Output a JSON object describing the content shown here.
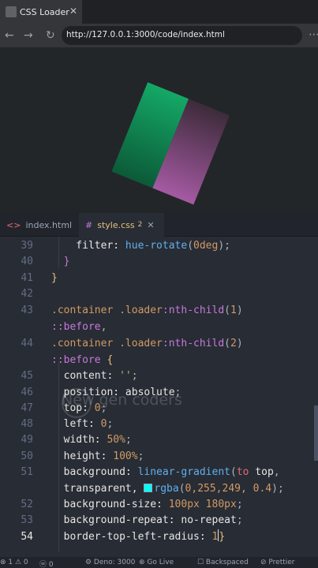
{
  "browser": {
    "tab_title": "CSS Loader",
    "tab_close": "✕",
    "back": "←",
    "forward": "→",
    "reload": "↻",
    "url": "http://127.0.0.1:3000/code/index.html",
    "more": "⋯"
  },
  "preview": {
    "square_green": "#0e7a4a",
    "square_purple": "#7d3d78"
  },
  "editor_tabs": [
    {
      "icon": "<>",
      "label": "index.html",
      "active": false
    },
    {
      "icon": "#",
      "label": "style.css",
      "badge": "2",
      "close": "✕",
      "active": true
    }
  ],
  "code": {
    "lines": [
      {
        "num": "39",
        "tokens": [
          [
            "prop",
            "    filter: "
          ],
          [
            "fn",
            "hue-rotate"
          ],
          [
            "punc",
            "("
          ],
          [
            "num",
            "0deg"
          ],
          [
            "punc",
            ");"
          ]
        ]
      },
      {
        "num": "40",
        "tokens": [
          [
            "brace-p",
            "  }"
          ]
        ]
      },
      {
        "num": "41",
        "tokens": [
          [
            "brace-y",
            "}"
          ]
        ]
      },
      {
        "num": "42",
        "tokens": []
      },
      {
        "num": "43",
        "tokens": [
          [
            "sel",
            ".container .loader"
          ],
          [
            "pseudo",
            ":nth-child"
          ],
          [
            "punc",
            "("
          ],
          [
            "num",
            "1"
          ],
          [
            "punc",
            ")"
          ]
        ]
      },
      {
        "num": "",
        "tokens": [
          [
            "pseudo",
            "::before"
          ],
          [
            "punc",
            ","
          ]
        ]
      },
      {
        "num": "44",
        "tokens": [
          [
            "sel",
            ".container .loader"
          ],
          [
            "pseudo",
            ":nth-child"
          ],
          [
            "punc",
            "("
          ],
          [
            "num",
            "2"
          ],
          [
            "punc",
            ")"
          ]
        ]
      },
      {
        "num": "",
        "tokens": [
          [
            "pseudo",
            "::before "
          ],
          [
            "brace-y",
            "{"
          ]
        ]
      },
      {
        "num": "45",
        "tokens": [
          [
            "prop",
            "  content: "
          ],
          [
            "str",
            "''"
          ],
          [
            "punc",
            ";"
          ]
        ]
      },
      {
        "num": "46",
        "tokens": [
          [
            "prop",
            "  position: "
          ],
          [
            "val",
            "absolute"
          ],
          [
            "punc",
            ";"
          ]
        ]
      },
      {
        "num": "47",
        "tokens": [
          [
            "prop",
            "  top: "
          ],
          [
            "num",
            "0"
          ],
          [
            "punc",
            ";"
          ]
        ]
      },
      {
        "num": "48",
        "tokens": [
          [
            "prop",
            "  left: "
          ],
          [
            "num",
            "0"
          ],
          [
            "punc",
            ";"
          ]
        ]
      },
      {
        "num": "49",
        "tokens": [
          [
            "prop",
            "  width: "
          ],
          [
            "num",
            "50%"
          ],
          [
            "punc",
            ";"
          ]
        ]
      },
      {
        "num": "50",
        "tokens": [
          [
            "prop",
            "  height: "
          ],
          [
            "num",
            "100%"
          ],
          [
            "punc",
            ";"
          ]
        ]
      },
      {
        "num": "51",
        "tokens": [
          [
            "prop",
            "  background: "
          ],
          [
            "fn",
            "linear-gradient"
          ],
          [
            "punc",
            "("
          ],
          [
            "kw",
            "to"
          ],
          [
            "val",
            " top"
          ],
          [
            "punc",
            ","
          ]
        ]
      },
      {
        "num": "",
        "tokens": [
          [
            "val",
            "  transparent, "
          ],
          [
            "swatch",
            ""
          ],
          [
            "fn",
            "rgba"
          ],
          [
            "punc",
            "("
          ],
          [
            "num",
            "0,255,249, 0.4"
          ],
          [
            "punc",
            ");"
          ]
        ]
      },
      {
        "num": "52",
        "tokens": [
          [
            "prop",
            "  background-size: "
          ],
          [
            "num",
            "100px 180px"
          ],
          [
            "punc",
            ";"
          ]
        ]
      },
      {
        "num": "53",
        "tokens": [
          [
            "prop",
            "  background-repeat: "
          ],
          [
            "val",
            "no-repeat"
          ],
          [
            "punc",
            ";"
          ]
        ]
      },
      {
        "num": "54",
        "active": true,
        "tokens": [
          [
            "prop",
            "  border-top-left-radius: "
          ],
          [
            "num",
            "1"
          ],
          [
            "cursor",
            ""
          ],
          [
            "brace-y",
            "}"
          ]
        ]
      }
    ]
  },
  "watermark": "New gen coders",
  "statusbar": {
    "items": [
      "⊗ 1 ⚠ 0",
      "ⓦ 0",
      "⚙ Deno: 3000",
      "⊕ Go Live",
      "☐ Backspaced",
      "⊘ Prettier"
    ]
  }
}
